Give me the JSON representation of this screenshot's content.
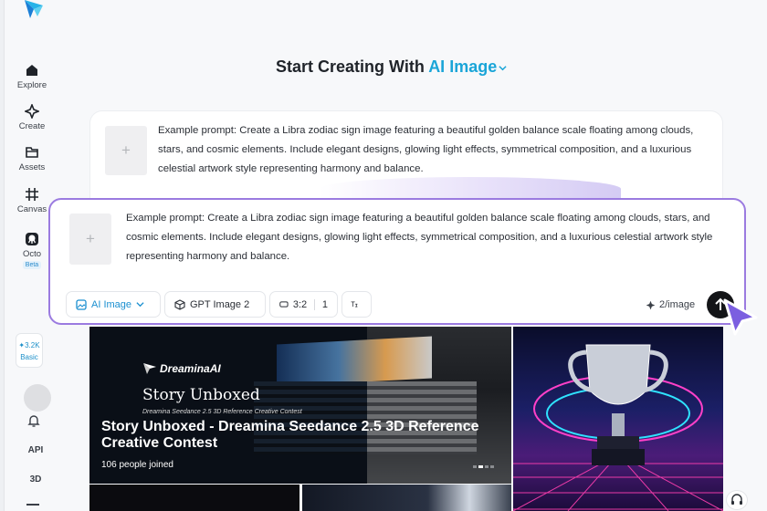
{
  "sidebar": {
    "items": [
      {
        "label": "Explore",
        "icon": "home-icon"
      },
      {
        "label": "Create",
        "icon": "sparkle-icon"
      },
      {
        "label": "Assets",
        "icon": "folder-icon"
      },
      {
        "label": "Canvas",
        "icon": "canvas-icon"
      },
      {
        "label": "Octo",
        "icon": "octo-icon",
        "badge": "Beta"
      }
    ],
    "credits": {
      "amount": "3.2K",
      "plan": "Basic"
    },
    "api_label": "API",
    "three_d_label": "3D"
  },
  "header": {
    "title_prefix": "Start Creating With",
    "title_accent": "AI Image"
  },
  "prompt_back": {
    "text": "Example prompt: Create a Libra zodiac sign image featuring a beautiful golden balance scale floating among clouds, stars, and cosmic elements. Include elegant designs, glowing light effects, symmetrical composition, and a luxurious celestial artwork style representing harmony and balance.",
    "add_glyph": "+"
  },
  "prompt_front": {
    "text": "Example prompt: Create a Libra zodiac sign image featuring a beautiful golden balance scale floating among clouds, stars, and cosmic elements. Include elegant designs, glowing light effects, symmetrical composition, and a luxurious celestial artwork style representing harmony and balance.",
    "add_glyph": "+"
  },
  "toolbar": {
    "mode_label": "AI Image",
    "model_label": "GPT Image 2",
    "ratio_label": "3:2",
    "count_label": "1",
    "cost_label": "2/image"
  },
  "banner": {
    "brand": "DreaminaAI",
    "script_title": "Story Unboxed",
    "subtitle": "Dreamina Seedance 2.5 3D Reference Creative Contest",
    "title": "Story Unboxed - Dreamina Seedance 2.5 3D Reference Creative Contest",
    "joined": "106 people joined"
  },
  "colors": {
    "accent": "#1aa5d8",
    "prompt_border": "#9b7be0",
    "send_button": "#141518"
  }
}
